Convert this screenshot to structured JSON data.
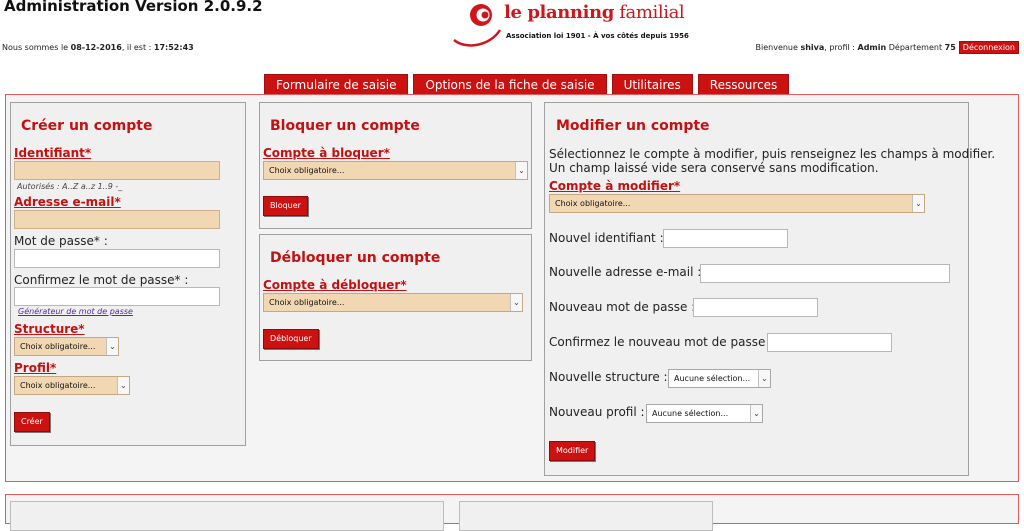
{
  "header": {
    "app_title": "Administration Version 2.0.9.2",
    "datetime_prefix": "Nous sommes le",
    "date": "08-12-2016",
    "time_sep": ", il est :",
    "time": "17:52:43",
    "logo_name_bold": "le planning",
    "logo_name_light": " familial",
    "logo_tagline": "Association loi 1901 - À vos côtés depuis 1956",
    "welcome_prefix": "Bienvenue",
    "user": "shiva",
    "profile_sep": ", profil :",
    "profile": "Admin",
    "dept_label": "Département",
    "dept": "75",
    "logout": "Déconnexion"
  },
  "menu": [
    {
      "label": "Formulaire de saisie"
    },
    {
      "label": "Options de la fiche de saisie"
    },
    {
      "label": "Utilitaires"
    },
    {
      "label": "Ressources"
    }
  ],
  "create": {
    "title": "Créer un compte",
    "identifiant_label": "Identifiant*",
    "identifiant_hint": "Autorisés : A..Z a..z 1..9 -_",
    "email_label": "Adresse e-mail*",
    "password_label": "Mot de passe* :",
    "confirm_label": "Confirmez le mot de passe* :",
    "generator_link": "Générateur de mot de passe",
    "structure_label": "Structure*",
    "structure_value": "Choix obligatoire...",
    "profile_label": "Profil*",
    "profile_value": "Choix obligatoire...",
    "submit": "Créer"
  },
  "block": {
    "title": "Bloquer un compte",
    "account_label": "Compte à bloquer*",
    "account_value": "Choix obligatoire...",
    "submit": "Bloquer"
  },
  "unblock": {
    "title": "Débloquer un compte",
    "account_label": "Compte à débloquer*",
    "account_value": "Choix obligatoire...",
    "submit": "Débloquer"
  },
  "modify": {
    "title": "Modifier un compte",
    "instructions_1": "Sélectionnez le compte à modifier, puis renseignez les champs à modifier.",
    "instructions_2": "Un champ laissé vide sera conservé sans modification.",
    "account_label": "Compte à modifier*",
    "account_value": "Choix obligatoire...",
    "new_id_label": "Nouvel identifiant :",
    "new_email_label": "Nouvelle adresse e-mail :",
    "new_password_label": "Nouveau mot de passe :",
    "confirm_password_label": "Confirmez le nouveau mot de passe :",
    "new_structure_label": "Nouvelle structure :",
    "new_structure_value": "Aucune sélection...",
    "new_profile_label": "Nouveau profil :",
    "new_profile_value": "Aucune sélection...",
    "submit": "Modifier"
  },
  "colors": {
    "brand_red": "#cc1111",
    "required_field_bg": "#f2d8b2",
    "frame_border": "#e45a5a"
  }
}
